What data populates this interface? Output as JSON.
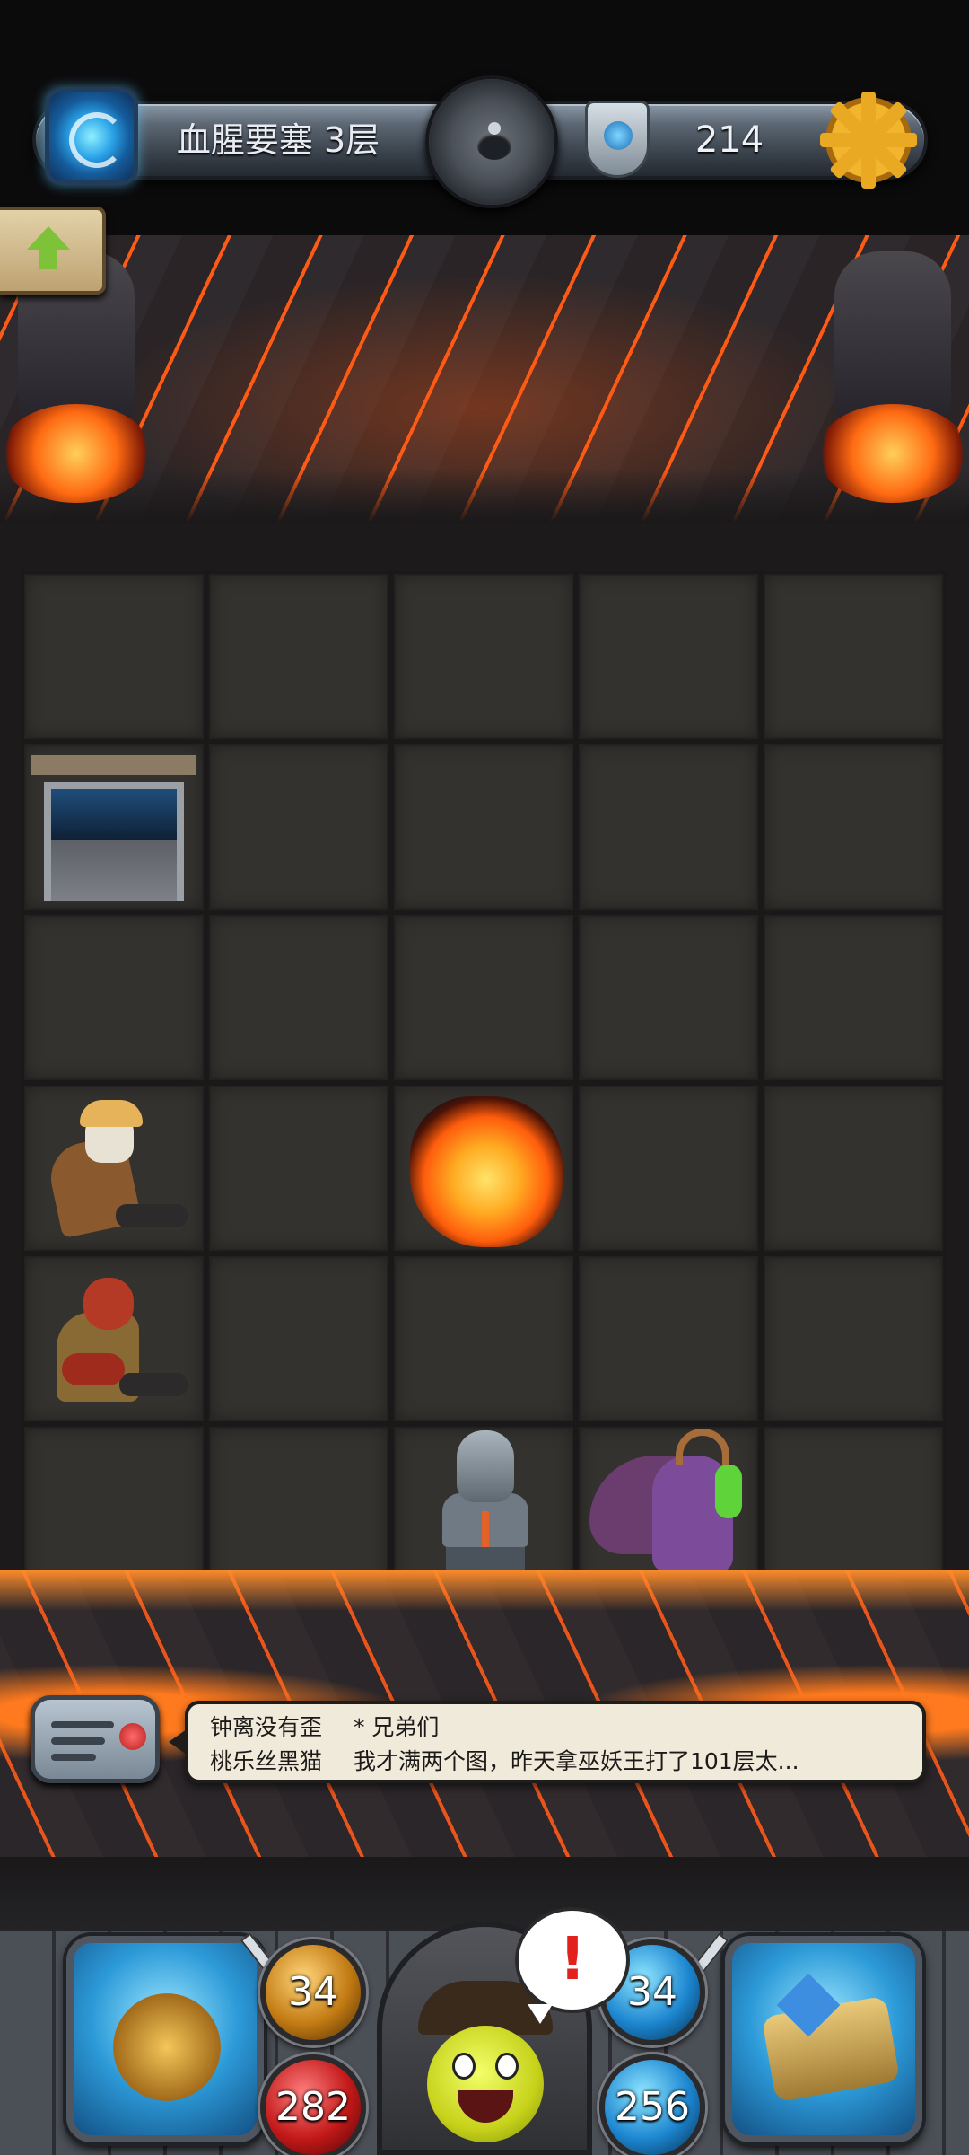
{
  "header": {
    "floor_title": "血腥要塞 3层",
    "gold": "214"
  },
  "chat": {
    "messages": [
      {
        "name": "钟离没有歪",
        "text": "* 兄弟们"
      },
      {
        "name": "桃乐丝黑猫",
        "text": "我才满两个图，昨天拿巫妖王打了101层太..."
      }
    ]
  },
  "stats": {
    "attack": "34",
    "defense": "34",
    "hp": "282",
    "mp": "256"
  },
  "hero": {
    "alert": "!"
  },
  "board": {
    "rows": 6,
    "cols": 5,
    "objects": [
      {
        "row": 1,
        "col": 0,
        "type": "stairs-down"
      },
      {
        "row": 3,
        "col": 0,
        "type": "skeleton-detective"
      },
      {
        "row": 3,
        "col": 2,
        "type": "lava-pit"
      },
      {
        "row": 4,
        "col": 0,
        "type": "red-demon"
      },
      {
        "row": 5,
        "col": 2,
        "type": "gargoyle-statue"
      },
      {
        "row": 5,
        "col": 3,
        "type": "demon-hunter"
      }
    ]
  },
  "colors": {
    "lava": "#ff5a14",
    "floor_tile": "#34322f",
    "gold_gear": "#f2b52e",
    "alert_red": "#e3211c"
  },
  "icons": [
    "portal-icon",
    "bomb-icon",
    "shield-icon",
    "gear-icon",
    "up-arrow-icon",
    "chat-radio-icon",
    "equipment-icon",
    "bag-icon",
    "sword-icon"
  ]
}
